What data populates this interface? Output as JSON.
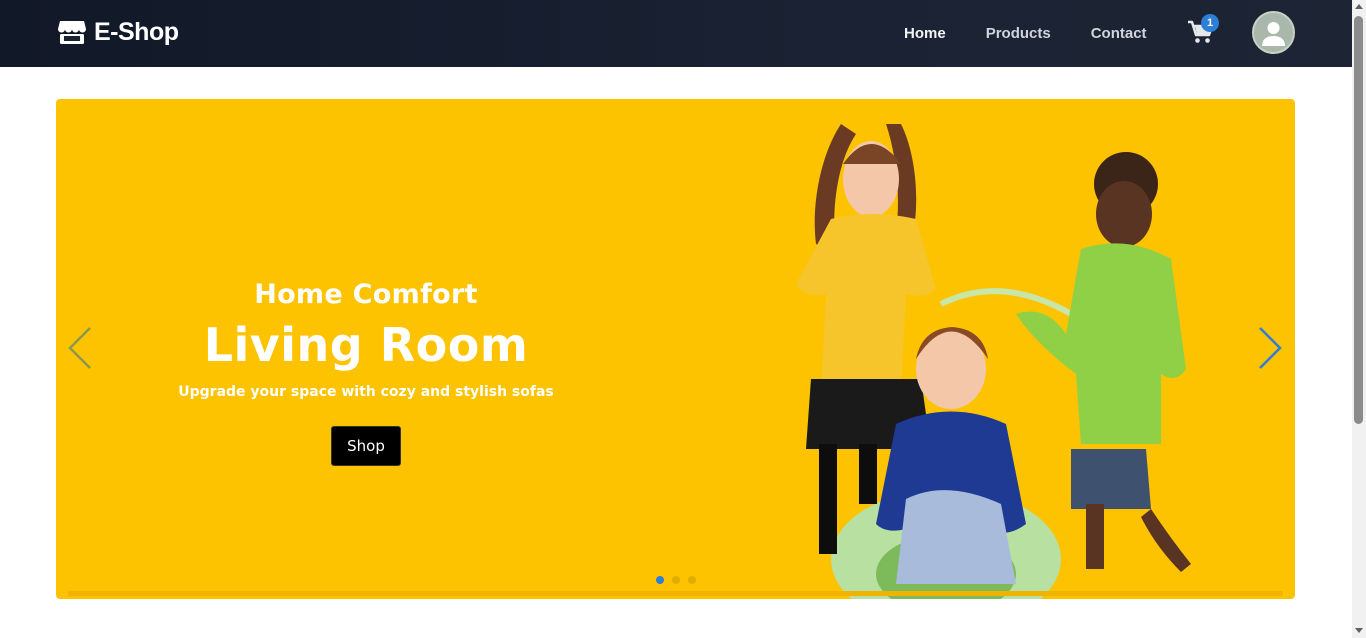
{
  "brand": {
    "name": "E-Shop"
  },
  "nav": {
    "home": "Home",
    "products": "Products",
    "contact": "Contact"
  },
  "cart": {
    "count": "1"
  },
  "hero": {
    "subtitle": "Home Comfort",
    "title": "Living Room",
    "description": "Upgrade your space with cozy and stylish sofas",
    "button": "Shop",
    "background_color": "#fdc300",
    "slide_index": 1,
    "slide_count": 3
  },
  "icons": {
    "logo": "store-icon",
    "cart": "shopping-cart-icon",
    "avatar": "user-icon",
    "prev": "chevron-left-icon",
    "next": "chevron-right-icon"
  },
  "colors": {
    "navbar": "#111827",
    "accent": "#2b7fd4",
    "button": "#000000"
  }
}
